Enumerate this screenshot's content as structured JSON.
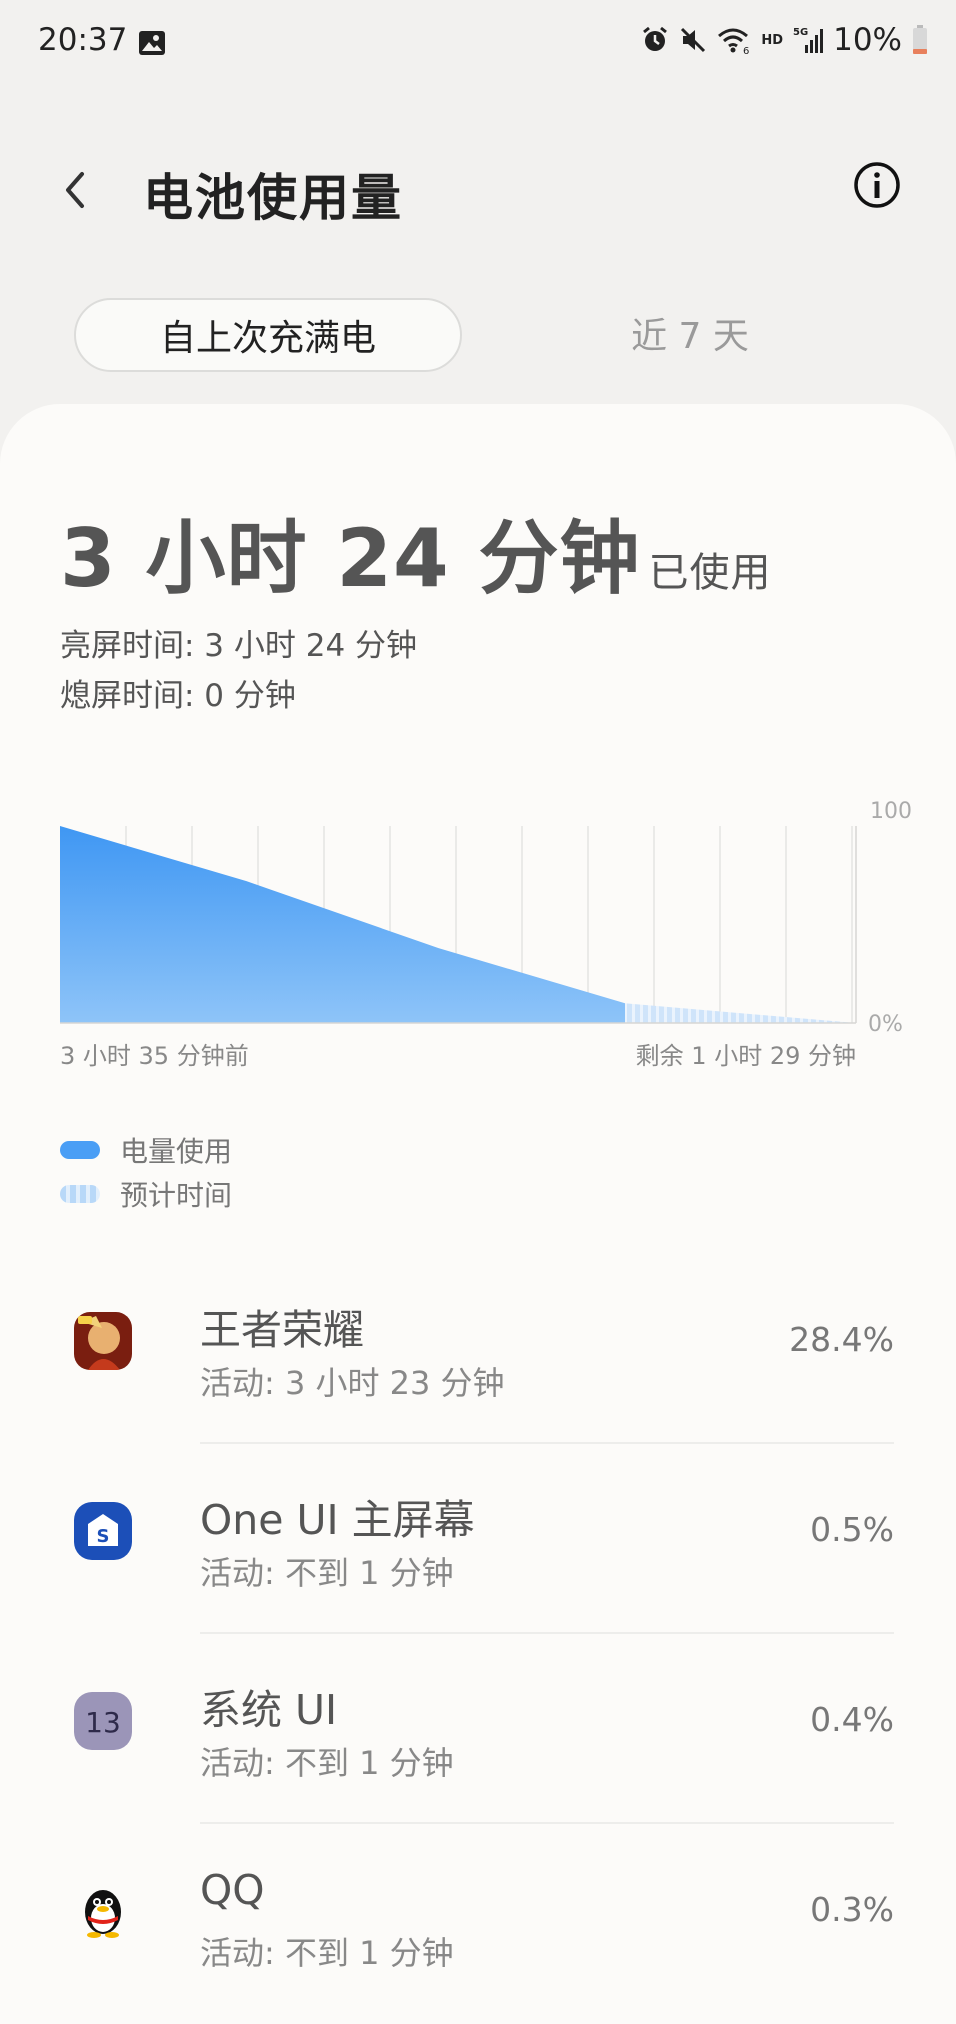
{
  "status_bar": {
    "time": "20:37",
    "battery_percent": "10%",
    "network_label_hd": "HD",
    "network_label_5g": "5G",
    "icons": [
      "image-icon",
      "alarm-icon",
      "mute-icon",
      "wifi-icon",
      "signal-icon",
      "battery-icon"
    ]
  },
  "header": {
    "title": "电池使用量",
    "back_icon": "chevron-left-icon",
    "info_icon": "info-icon"
  },
  "tabs": [
    {
      "label": "自上次充满电",
      "selected": true
    },
    {
      "label": "近 7 天",
      "selected": false
    }
  ],
  "summary": {
    "usage_main": "3 小时 24 分钟",
    "usage_suffix": "已使用",
    "screen_on": "亮屏时间:  3 小时 24 分钟",
    "screen_off": "熄屏时间:   0 分钟"
  },
  "chart_data": {
    "type": "area",
    "y_labels": [
      "100",
      "0%"
    ],
    "x_start_label": "3 小时 35 分钟前",
    "x_end_label": "剩余 1 小时 29 分钟",
    "ylim": [
      0,
      100
    ],
    "series": [
      {
        "name": "电量使用",
        "points": [
          [
            0,
            100
          ],
          [
            0.33,
            72
          ],
          [
            0.67,
            38
          ],
          [
            1.0,
            10
          ]
        ],
        "color": "#4a9ef5"
      },
      {
        "name": "预计时间",
        "points": [
          [
            1.0,
            10
          ],
          [
            1.41,
            0
          ]
        ],
        "color": "#b8d8f8"
      }
    ]
  },
  "legend": [
    {
      "label": "电量使用",
      "color": "#4a9ef5"
    },
    {
      "label": "预计时间",
      "color": "#b8d8f8"
    }
  ],
  "apps": [
    {
      "name": "王者荣耀",
      "activity": "活动: 3 小时 23 分钟",
      "percent": "28.4%",
      "icon": "honor-of-kings-icon"
    },
    {
      "name": "One UI 主屏幕",
      "activity": "活动: 不到 1 分钟",
      "percent": "0.5%",
      "icon": "one-ui-home-icon"
    },
    {
      "name": "系统 UI",
      "activity": "活动: 不到 1 分钟",
      "percent": "0.4%",
      "icon": "system-ui-icon"
    },
    {
      "name": "QQ",
      "activity": "活动: 不到 1 分钟",
      "percent": "0.3%",
      "icon": "qq-penguin-icon"
    }
  ]
}
